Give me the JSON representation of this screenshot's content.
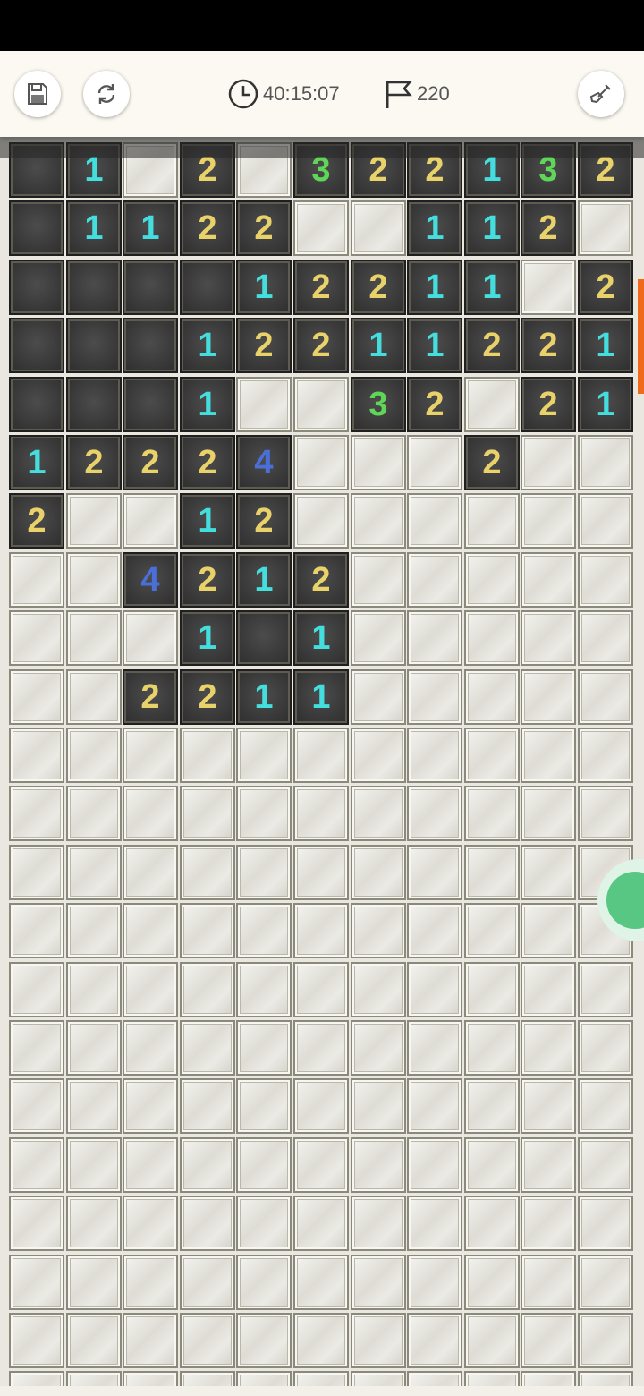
{
  "toolbar": {
    "save_icon": "save-icon",
    "restart_icon": "restart-icon",
    "timer_icon": "clock-icon",
    "timer": "40:15:07",
    "flag_icon": "flag-icon",
    "flags": "220",
    "tool_icon": "shovel-icon"
  },
  "board": {
    "columns": 11,
    "rows": [
      [
        "O",
        "1",
        "C",
        "2",
        "C",
        "3",
        "2",
        "2",
        "1",
        "3",
        "2"
      ],
      [
        "O",
        "1",
        "1",
        "2",
        "2",
        "C",
        "C",
        "1",
        "1",
        "2",
        "C"
      ],
      [
        "O",
        "O",
        "O",
        "O",
        "1",
        "2",
        "2",
        "1",
        "1",
        "C",
        "2"
      ],
      [
        "O",
        "O",
        "O",
        "1",
        "2",
        "2",
        "1",
        "1",
        "2",
        "2",
        "1"
      ],
      [
        "O",
        "O",
        "O",
        "1",
        "C",
        "C",
        "3",
        "2",
        "C",
        "2",
        "1"
      ],
      [
        "1",
        "2",
        "2",
        "2",
        "4",
        "C",
        "C",
        "C",
        "2",
        "C",
        "C"
      ],
      [
        "2",
        "C",
        "C",
        "1",
        "2",
        "C",
        "C",
        "C",
        "C",
        "C",
        "C"
      ],
      [
        "C",
        "C",
        "4",
        "2",
        "1",
        "2",
        "C",
        "C",
        "C",
        "C",
        "C"
      ],
      [
        "C",
        "C",
        "C",
        "1",
        "O",
        "1",
        "C",
        "C",
        "C",
        "C",
        "C"
      ],
      [
        "C",
        "C",
        "2",
        "2",
        "1",
        "1",
        "C",
        "C",
        "C",
        "C",
        "C"
      ],
      [
        "C",
        "C",
        "C",
        "C",
        "C",
        "C",
        "C",
        "C",
        "C",
        "C",
        "C"
      ],
      [
        "C",
        "C",
        "C",
        "C",
        "C",
        "C",
        "C",
        "C",
        "C",
        "C",
        "C"
      ],
      [
        "C",
        "C",
        "C",
        "C",
        "C",
        "C",
        "C",
        "C",
        "C",
        "C",
        "C"
      ],
      [
        "C",
        "C",
        "C",
        "C",
        "C",
        "C",
        "C",
        "C",
        "C",
        "C",
        "C"
      ],
      [
        "C",
        "C",
        "C",
        "C",
        "C",
        "C",
        "C",
        "C",
        "C",
        "C",
        "C"
      ],
      [
        "C",
        "C",
        "C",
        "C",
        "C",
        "C",
        "C",
        "C",
        "C",
        "C",
        "C"
      ],
      [
        "C",
        "C",
        "C",
        "C",
        "C",
        "C",
        "C",
        "C",
        "C",
        "C",
        "C"
      ],
      [
        "C",
        "C",
        "C",
        "C",
        "C",
        "C",
        "C",
        "C",
        "C",
        "C",
        "C"
      ],
      [
        "C",
        "C",
        "C",
        "C",
        "C",
        "C",
        "C",
        "C",
        "C",
        "C",
        "C"
      ],
      [
        "C",
        "C",
        "C",
        "C",
        "C",
        "C",
        "C",
        "C",
        "C",
        "C",
        "C"
      ],
      [
        "C",
        "C",
        "C",
        "C",
        "C",
        "C",
        "C",
        "C",
        "C",
        "C",
        "C"
      ],
      [
        "C",
        "C",
        "C",
        "C",
        "C",
        "C",
        "C",
        "C",
        "C",
        "C",
        "C"
      ]
    ],
    "number_colors": {
      "1": "#45dede",
      "2": "#ead26a",
      "3": "#5fd657",
      "4": "#4a6fd9"
    }
  },
  "colors": {
    "accent": "#f06a1c",
    "chat": "#58c783"
  },
  "chat_icon": "chat-bubble-icon"
}
